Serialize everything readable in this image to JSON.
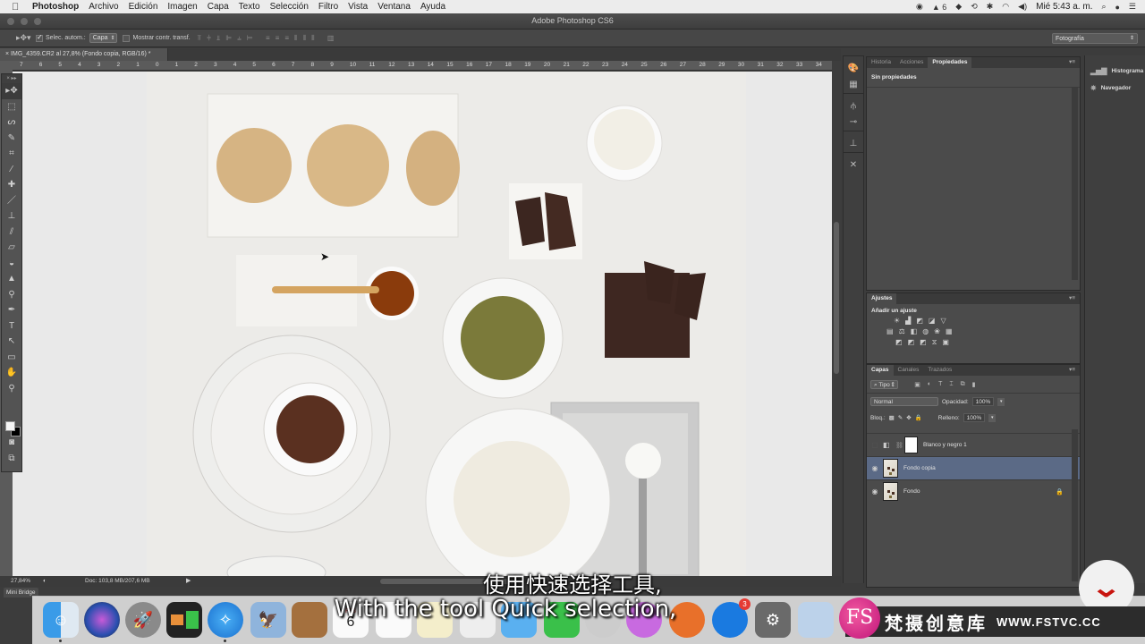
{
  "menubar": {
    "app_name": "Photoshop",
    "items": [
      "Archivo",
      "Edición",
      "Imagen",
      "Capa",
      "Texto",
      "Selección",
      "Filtro",
      "Vista",
      "Ventana",
      "Ayuda"
    ],
    "status": {
      "adobe_count": "6",
      "clock": "Mié 5:43 a. m."
    }
  },
  "window": {
    "title": "Adobe Photoshop CS6"
  },
  "options_bar": {
    "auto_select_label": "Selec. autom.:",
    "auto_select_checked": true,
    "auto_select_value": "Capa",
    "show_transform_label": "Mostrar contr. transf.",
    "show_transform_checked": false,
    "workspace": "Fotografía"
  },
  "document": {
    "tab_title": "IMG_4359.CR2 al 27,8% (Fondo copia, RGB/16) *",
    "ruler_labels": [
      "7",
      "6",
      "5",
      "4",
      "3",
      "2",
      "1",
      "0",
      "1",
      "2",
      "3",
      "4",
      "5",
      "6",
      "7",
      "8",
      "9",
      "10",
      "11",
      "12",
      "13",
      "14",
      "15",
      "16",
      "17",
      "18",
      "19",
      "20",
      "21",
      "22",
      "23",
      "24",
      "25",
      "26",
      "27",
      "28",
      "29",
      "30",
      "31",
      "32",
      "33",
      "34"
    ],
    "zoom": "27,84%",
    "doc_size": "Doc: 103,8 MB/207,6 MB"
  },
  "mini_bridge": "Mini Bridge",
  "tools": [
    "move",
    "marquee",
    "lasso",
    "quick-selection",
    "crop",
    "eyedropper",
    "healing-brush",
    "brush",
    "clone-stamp",
    "history-brush",
    "eraser",
    "paint-bucket",
    "blur",
    "dodge",
    "pen",
    "type",
    "path-selection",
    "rectangle",
    "hand",
    "zoom"
  ],
  "panels": {
    "properties": {
      "tabs": [
        "Historia",
        "Acciones",
        "Propiedades"
      ],
      "active_tab": "Propiedades",
      "content": "Sin propiedades"
    },
    "adjustments": {
      "tab": "Ajustes",
      "heading": "Añadir un ajuste"
    },
    "layers": {
      "tabs": [
        "Capas",
        "Canales",
        "Trazados"
      ],
      "filter": "Tipo",
      "blend_mode": "Normal",
      "opacity_label": "Opacidad:",
      "opacity": "100%",
      "lock_label": "Bloq.:",
      "fill_label": "Relleno:",
      "fill": "100%",
      "items": [
        {
          "name": "Blanco y negro 1",
          "visible": false,
          "selected": false,
          "locked": false,
          "type": "adjustment"
        },
        {
          "name": "Fondo copia",
          "visible": true,
          "selected": true,
          "locked": false,
          "type": "pixel"
        },
        {
          "name": "Fondo",
          "visible": true,
          "selected": false,
          "locked": true,
          "type": "pixel"
        }
      ]
    },
    "side": [
      {
        "label": "Histograma"
      },
      {
        "label": "Navegador"
      }
    ]
  },
  "dock": {
    "apps": [
      "Finder",
      "Siri",
      "Launchpad",
      "Mission Control",
      "Safari",
      "Mail",
      "Contacts",
      "Calendar",
      "Reminders",
      "Notes",
      "Photos",
      "Messages",
      "FaceTime",
      "Photos",
      "iTunes",
      "iBooks",
      "App Store",
      "System Preferences",
      "Preview"
    ],
    "calendar": {
      "month": "FEB",
      "day": "6"
    },
    "app_store_badge": "3"
  },
  "subtitles": {
    "chinese": "使用快速选择工具,",
    "english": "With the tool Quick selection,"
  },
  "watermark": {
    "logo": "FS",
    "name": "梵摄创意库",
    "url": "WWW.FSTVC.CC"
  }
}
